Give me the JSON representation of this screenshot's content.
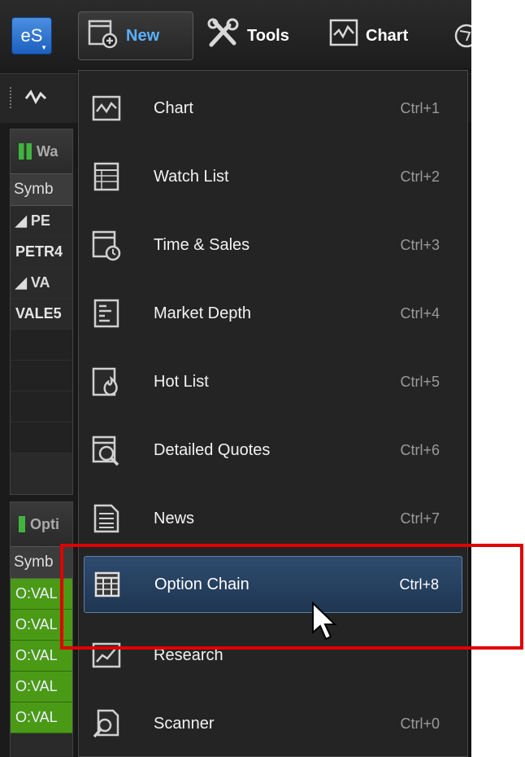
{
  "toolbar": {
    "logo": "eS",
    "new_label": "New",
    "tools_label": "Tools",
    "chart_label": "Chart"
  },
  "watchlist_panel": {
    "title": "Wa",
    "column": "Symb",
    "rows": [
      "◢ PE",
      "PETR4",
      "◢ VA",
      "VALE5"
    ]
  },
  "option_panel": {
    "title": "Opti",
    "column": "Symb",
    "rows": [
      "O:VAL",
      "O:VAL",
      "O:VAL",
      "O:VAL",
      "O:VAL"
    ]
  },
  "menu": {
    "items": [
      {
        "label": "Chart",
        "shortcut": "Ctrl+1",
        "icon": "chart-icon"
      },
      {
        "label": "Watch List",
        "shortcut": "Ctrl+2",
        "icon": "watch-list-icon"
      },
      {
        "label": "Time & Sales",
        "shortcut": "Ctrl+3",
        "icon": "time-sales-icon"
      },
      {
        "label": "Market Depth",
        "shortcut": "Ctrl+4",
        "icon": "market-depth-icon"
      },
      {
        "label": "Hot List",
        "shortcut": "Ctrl+5",
        "icon": "hot-list-icon"
      },
      {
        "label": "Detailed Quotes",
        "shortcut": "Ctrl+6",
        "icon": "detailed-quotes-icon"
      },
      {
        "label": "News",
        "shortcut": "Ctrl+7",
        "icon": "news-icon"
      },
      {
        "label": "Option Chain",
        "shortcut": "Ctrl+8",
        "icon": "option-chain-icon"
      },
      {
        "label": "Research",
        "shortcut": "",
        "icon": "research-icon"
      },
      {
        "label": "Scanner",
        "shortcut": "Ctrl+0",
        "icon": "scanner-icon"
      }
    ]
  },
  "colors": {
    "highlight": "#2e4b6e",
    "annotation": "#e00000",
    "option_row": "#4a9a16",
    "new_label": "#5ab0ff"
  }
}
